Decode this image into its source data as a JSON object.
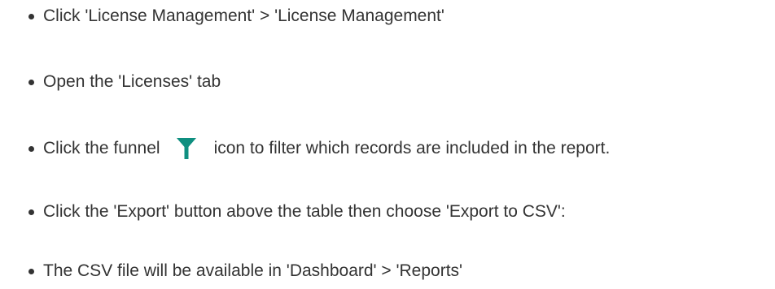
{
  "steps": [
    {
      "text": "Click 'License Management' > 'License Management'"
    },
    {
      "text": "Open the 'Licenses' tab"
    },
    {
      "text_before": "Click the funnel",
      "icon": "funnel-icon",
      "text_after": "icon to filter which records are included in the report."
    },
    {
      "text": "Click the 'Export' button above the table then choose 'Export to CSV':"
    },
    {
      "text": "The CSV file will be available in 'Dashboard' > 'Reports'"
    }
  ],
  "colors": {
    "text": "#333333",
    "funnel_icon": "#0f8f80"
  }
}
